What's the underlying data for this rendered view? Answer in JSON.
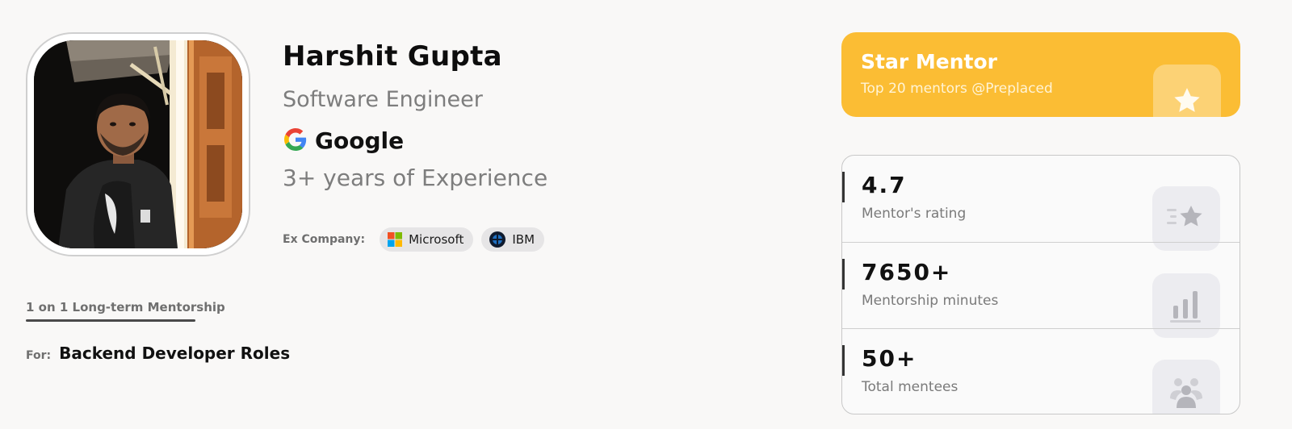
{
  "profile": {
    "name": "Harshit Gupta",
    "role": "Software Engineer",
    "company": "Google",
    "experience": "3+ years of Experience",
    "ex_company_label": "Ex Company:",
    "ex_companies": [
      {
        "name": "Microsoft",
        "icon": "microsoft-logo-icon"
      },
      {
        "name": "IBM",
        "icon": "ibm-logo-icon"
      }
    ]
  },
  "mentorship": {
    "type": "1 on 1 Long-term Mentorship",
    "for_label": "For:",
    "for_value": "Backend Developer Roles"
  },
  "badge": {
    "title": "Star Mentor",
    "subtitle": "Top 20 mentors @Preplaced",
    "icon": "star-icon",
    "color": "#fbbd34"
  },
  "stats": [
    {
      "value": "4.7",
      "label": "Mentor's rating",
      "icon": "star-rating-icon"
    },
    {
      "value": "7650+",
      "label": "Mentorship minutes",
      "icon": "bar-chart-icon"
    },
    {
      "value": "50+",
      "label": "Total mentees",
      "icon": "users-icon"
    }
  ]
}
